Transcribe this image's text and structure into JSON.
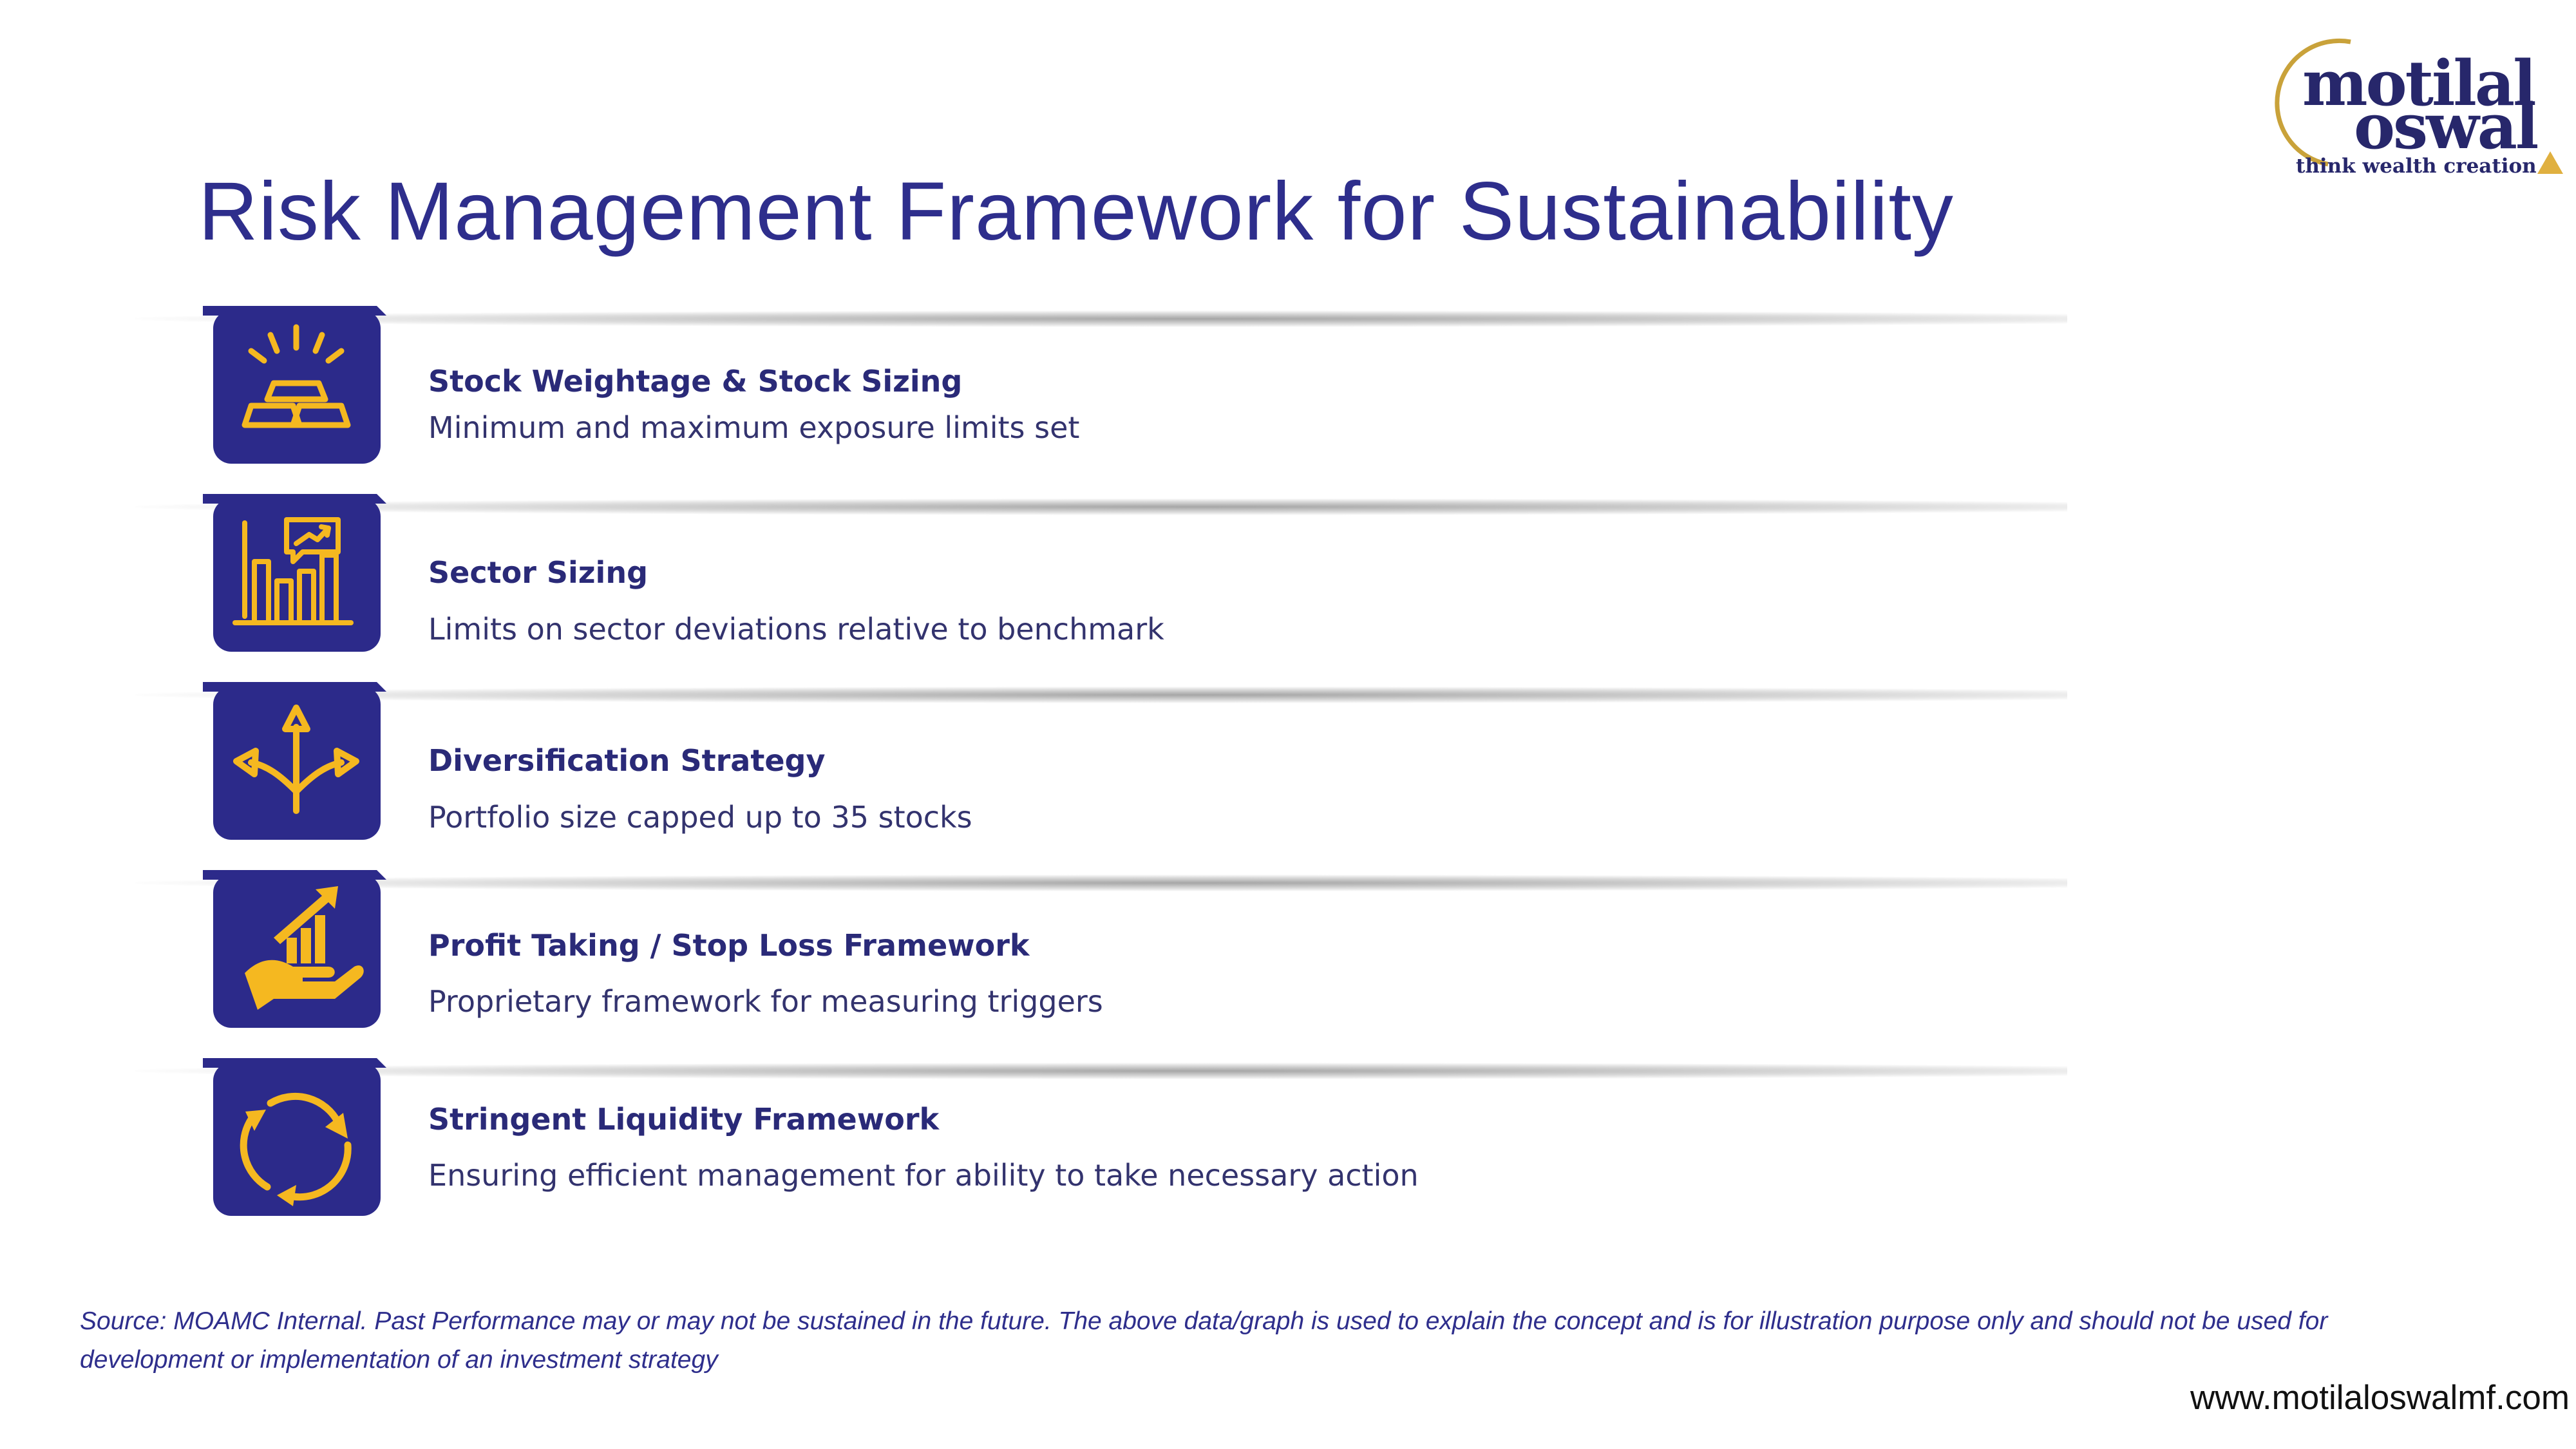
{
  "page": {
    "title": "Risk Management Framework for Sustainability"
  },
  "logo": {
    "line1": "motilal",
    "line2": "oswal",
    "tagline": "think wealth creation"
  },
  "colors": {
    "primary_navy": "#2e2e8c",
    "icon_bg": "#2c2a8a",
    "icon_accent": "#f5b820"
  },
  "items": [
    {
      "title": "Stock Weightage & Stock Sizing",
      "description": "Minimum and maximum exposure limits set",
      "icon": "gold-bars-icon"
    },
    {
      "title": "Sector Sizing",
      "description": "Limits on sector deviations relative to benchmark",
      "icon": "bar-chart-icon"
    },
    {
      "title": "Diversification Strategy",
      "description": "Portfolio size capped up to 35 stocks",
      "icon": "diverging-arrows-icon"
    },
    {
      "title": "Profit Taking / Stop Loss Framework",
      "description": "Proprietary framework for measuring triggers",
      "icon": "growth-hand-icon"
    },
    {
      "title": "Stringent Liquidity Framework",
      "description": "Ensuring efficient management for ability to take necessary action",
      "icon": "cycle-arrows-icon"
    }
  ],
  "footer": {
    "source": "Source: MOAMC Internal. Past Performance may or may not be sustained in the future. The above data/graph is used to explain the concept and is for illustration purpose only and should not be used for development or implementation of an investment strategy",
    "website": "www.motilaloswalmf.com"
  }
}
